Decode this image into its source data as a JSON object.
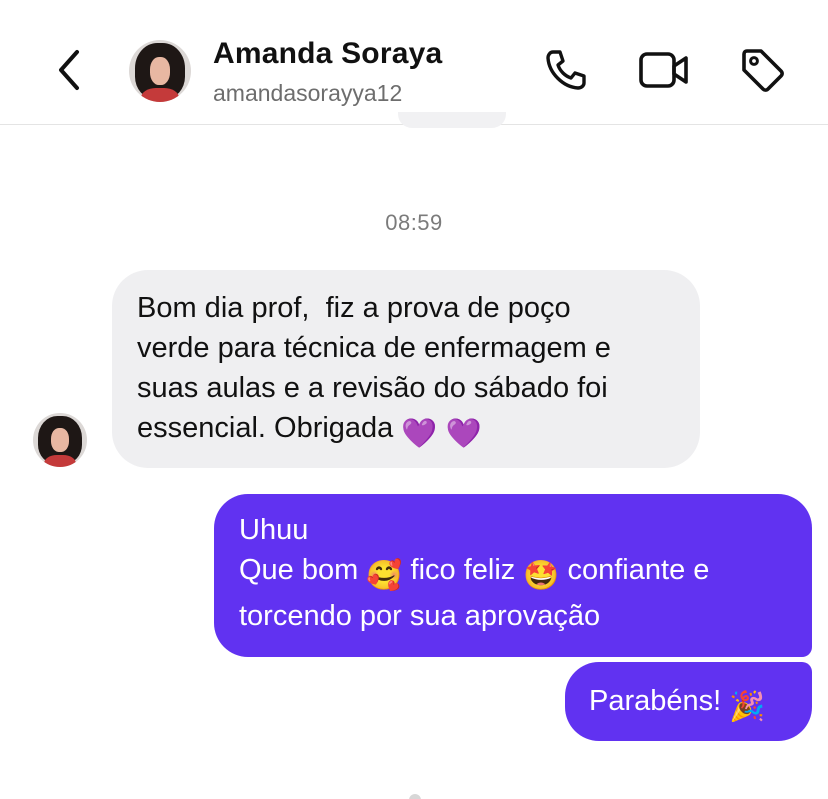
{
  "header": {
    "contact_name": "Amanda Soraya",
    "contact_handle": "amandasorayya12",
    "icons": [
      "chevron-left-icon",
      "phone-icon",
      "video-camera-icon",
      "tag-icon"
    ]
  },
  "thread": {
    "timestamp": "08:59",
    "incoming": {
      "lines": [
        "Bom dia prof,  fiz a prova de poço",
        "verde para técnica de enfermagem e",
        "suas aulas e a revisão do sábado foi",
        "essencial. Obrigada "
      ],
      "emoji": "💜 💜"
    },
    "outgoing": [
      {
        "line1": "Uhuu",
        "line2_a": "Que bom ",
        "emoji_a": "🥰",
        "line2_b": " fico feliz ",
        "emoji_b": "🤩",
        "line2_c": " confiante e",
        "line3": "torcendo por sua aprovação"
      },
      {
        "text": "Parabéns! ",
        "emoji": "🎉"
      }
    ]
  },
  "colors": {
    "outgoing_bubble": "#6132f1",
    "incoming_bubble": "#efeff1",
    "timestamp_text": "#7b7b7b",
    "header_divider": "#e4e4e4"
  }
}
